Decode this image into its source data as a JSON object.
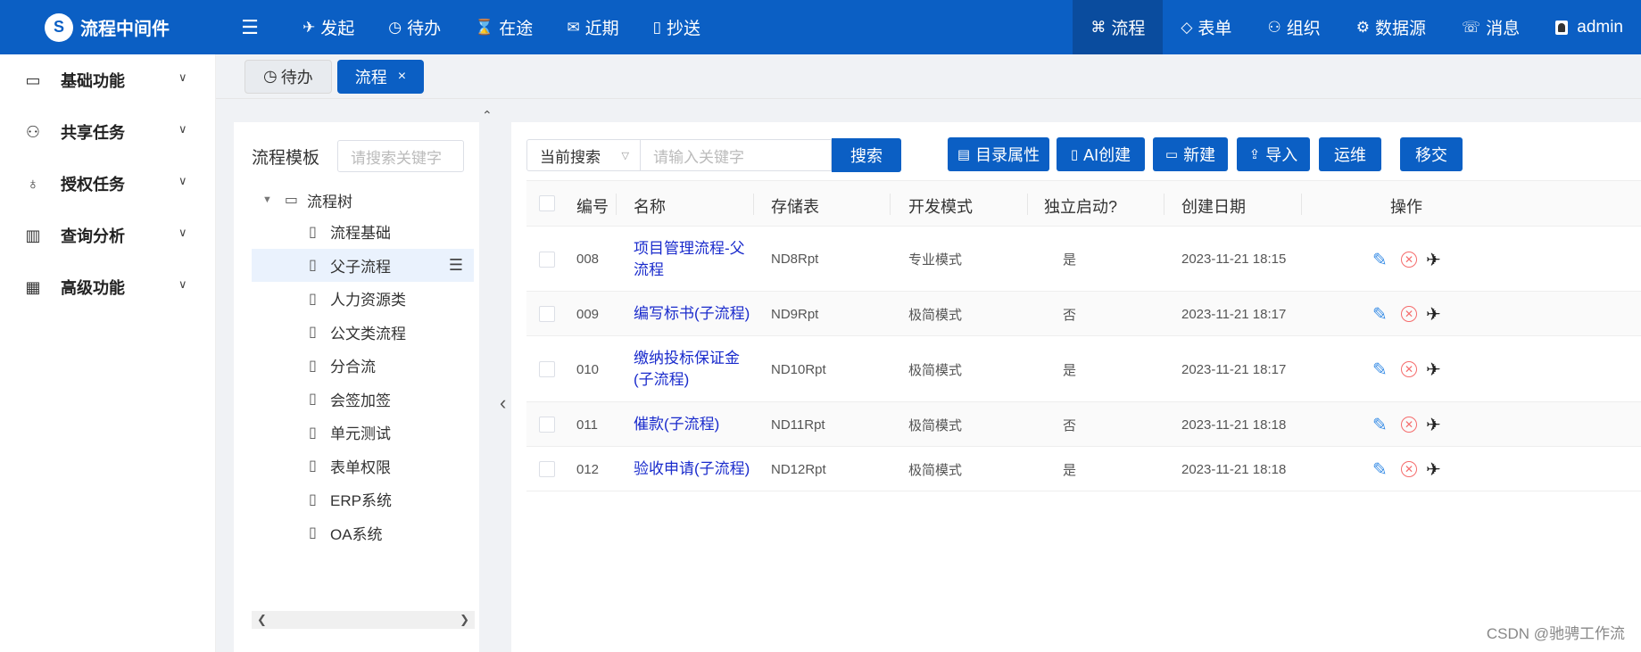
{
  "app": {
    "logo_text": "流程中间件",
    "logo_mark": "S"
  },
  "topnav": [
    {
      "label": "发起",
      "icon": "send-icon",
      "glyph": "✈"
    },
    {
      "label": "待办",
      "icon": "clock-icon",
      "glyph": "◷"
    },
    {
      "label": "在途",
      "icon": "hourglass-icon",
      "glyph": "⌛"
    },
    {
      "label": "近期",
      "icon": "mail-icon",
      "glyph": "✉"
    },
    {
      "label": "抄送",
      "icon": "clipboard-icon",
      "glyph": "▯"
    }
  ],
  "topright": [
    {
      "label": "流程",
      "icon": "flow-icon",
      "glyph": "⌘"
    },
    {
      "label": "表单",
      "icon": "diamond-icon",
      "glyph": "◇"
    },
    {
      "label": "组织",
      "icon": "user-icon",
      "glyph": "⚇"
    },
    {
      "label": "数据源",
      "icon": "gear-icon",
      "glyph": "⚙"
    },
    {
      "label": "消息",
      "icon": "chat-icon",
      "glyph": "☏"
    },
    {
      "label": "admin",
      "icon": "avatar-icon"
    }
  ],
  "sidebar": {
    "items": [
      {
        "label": "基础功能",
        "icon": "folder-icon",
        "glyph": "▭"
      },
      {
        "label": "共享任务",
        "icon": "users-icon",
        "glyph": "⚇"
      },
      {
        "label": "授权任务",
        "icon": "award-icon",
        "glyph": "♁"
      },
      {
        "label": "查询分析",
        "icon": "bar-chart-icon",
        "glyph": "▥"
      },
      {
        "label": "高级功能",
        "icon": "grid-icon",
        "glyph": "▦"
      }
    ]
  },
  "tabs": [
    {
      "label": "待办",
      "active": false
    },
    {
      "label": "流程",
      "active": true,
      "close": "×"
    }
  ],
  "tree": {
    "title": "流程模板",
    "search_placeholder": "请搜索关键字",
    "root": "流程树",
    "nodes": [
      "流程基础",
      "父子流程",
      "人力资源类",
      "公文类流程",
      "分合流",
      "会签加签",
      "单元测试",
      "表单权限",
      "ERP系统",
      "OA系统"
    ],
    "selected_index": 1
  },
  "toolbar": {
    "scope_select": "当前搜索",
    "keyword_placeholder": "请输入关键字",
    "search_label": "搜索",
    "buttons": [
      {
        "label": "目录属性",
        "icon": "document-icon",
        "glyph": "▤"
      },
      {
        "label": "AI创建",
        "icon": "file-icon",
        "glyph": "▯"
      },
      {
        "label": "新建",
        "icon": "folder-open-icon",
        "glyph": "▭"
      },
      {
        "label": "导入",
        "icon": "upload-icon",
        "glyph": "⇪"
      },
      {
        "label": "运维"
      },
      {
        "label": "移交"
      }
    ]
  },
  "table": {
    "columns": [
      "编号",
      "名称",
      "存储表",
      "开发模式",
      "独立启动?",
      "创建日期",
      "操作"
    ],
    "rows": [
      {
        "no": "008",
        "name": "项目管理流程-父流程",
        "table": "ND8Rpt",
        "mode": "专业模式",
        "standalone": "是",
        "created": "2023-11-21 18:15"
      },
      {
        "no": "009",
        "name": "编写标书(子流程)",
        "table": "ND9Rpt",
        "mode": "极简模式",
        "standalone": "否",
        "created": "2023-11-21 18:17"
      },
      {
        "no": "010",
        "name": "缴纳投标保证金(子流程)",
        "table": "ND10Rpt",
        "mode": "极简模式",
        "standalone": "是",
        "created": "2023-11-21 18:17"
      },
      {
        "no": "011",
        "name": "催款(子流程)",
        "table": "ND11Rpt",
        "mode": "极简模式",
        "standalone": "否",
        "created": "2023-11-21 18:18"
      },
      {
        "no": "012",
        "name": "验收申请(子流程)",
        "table": "ND12Rpt",
        "mode": "极简模式",
        "standalone": "是",
        "created": "2023-11-21 18:18"
      }
    ]
  },
  "watermark": "CSDN @驰骋工作流",
  "colors": {
    "primary": "#0b5fc4",
    "link": "#1a2bcc",
    "danger": "#f56c6c",
    "edit": "#3a8ee6"
  }
}
